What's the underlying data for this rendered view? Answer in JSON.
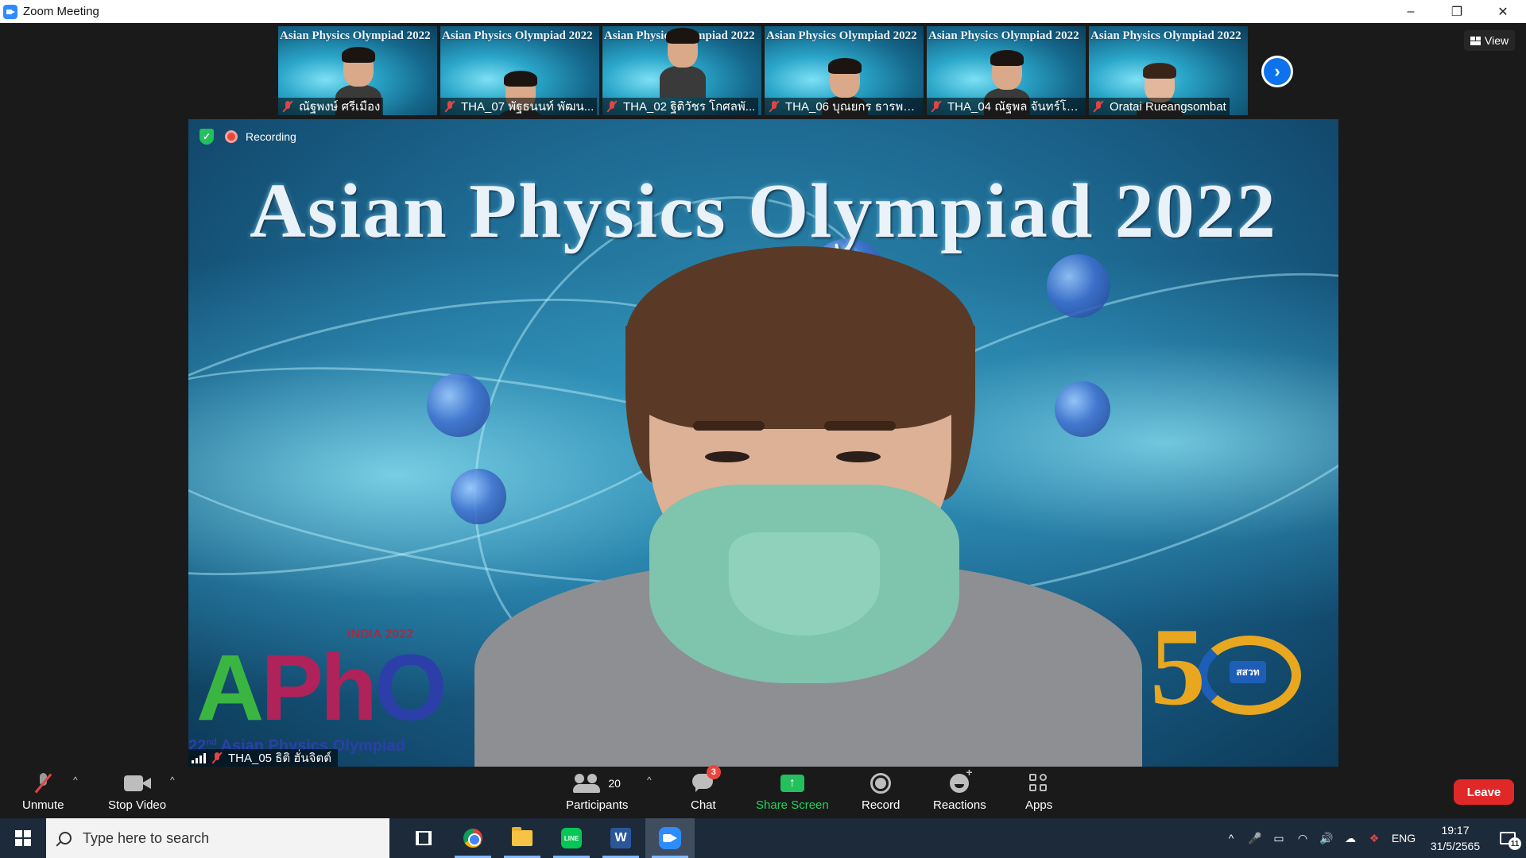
{
  "window": {
    "title": "Zoom Meeting",
    "controls": {
      "minimize": "–",
      "restore": "❐",
      "close": "✕"
    }
  },
  "thumbnails": {
    "background_title": "Asian Physics Olympiad 2022",
    "items": [
      {
        "name": "ณัฐพงษ์ ศรีเมือง",
        "muted": true
      },
      {
        "name": "THA_07 พัฐธนนท์ พัฒน...",
        "muted": true
      },
      {
        "name": "THA_02 ฐิติวัชร โกศลพั...",
        "muted": true
      },
      {
        "name": "THA_06 บุณยกร ธารพาน...",
        "muted": true
      },
      {
        "name": "THA_04 ณัฐพล จันทร์โพ...",
        "muted": true
      },
      {
        "name": "Oratai Rueangsombat",
        "muted": true
      }
    ],
    "next_icon": "›"
  },
  "view_button": {
    "label": "View",
    "icon": "grid-icon"
  },
  "main_video": {
    "recording_label": "Recording",
    "background_title": "Asian Physics Olympiad 2022",
    "speaker_name": "THA_05 ธิติ ฮั่นจิตต์",
    "apho_logo": {
      "india": "INDIA 2022",
      "letters_a": "A",
      "letters_ph": "Ph",
      "letters_o": "O",
      "sub_sup": "nd",
      "sub_num": "22",
      "sub_text": " Asian Physics Olympiad"
    },
    "logo50": {
      "number": "5",
      "badge": "สสวท"
    }
  },
  "toolbar": {
    "unmute": "Unmute",
    "stop_video": "Stop Video",
    "participants": "Participants",
    "participants_count": "20",
    "chat": "Chat",
    "chat_badge": "3",
    "share_screen": "Share Screen",
    "share_arrow": "↑",
    "record": "Record",
    "reactions": "Reactions",
    "apps": "Apps",
    "leave": "Leave",
    "caret": "^"
  },
  "taskbar": {
    "search_placeholder": "Type here to search",
    "line_icon_text": "LINE",
    "word_icon_text": "W",
    "language": "ENG",
    "time": "19:17",
    "date": "31/5/2565",
    "notification_count": "11",
    "tray_icons": {
      "chevron": "^",
      "mic": "🎤",
      "battery": "▭",
      "wifi": "◠",
      "volume": "🔊",
      "cloud": "☁",
      "dropbox": "❖"
    }
  },
  "colors": {
    "zoom_blue": "#2d8cff",
    "leave_red": "#e02828",
    "share_green": "#23c05c",
    "record_red": "#e8473d"
  }
}
